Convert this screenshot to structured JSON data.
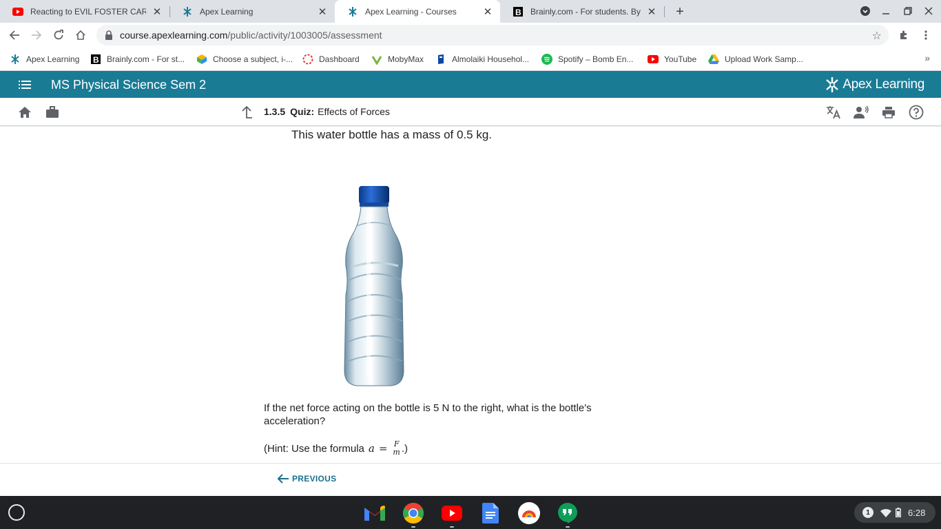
{
  "browser": {
    "tabs": [
      {
        "title": "Reacting to EVIL FOSTER CARE M",
        "favicon": "youtube-icon",
        "active": false
      },
      {
        "title": "Apex Learning",
        "favicon": "apex-icon",
        "active": false
      },
      {
        "title": "Apex Learning - Courses",
        "favicon": "apex-icon",
        "active": true
      },
      {
        "title": "Brainly.com - For students. By st",
        "favicon": "brainly-icon",
        "active": false
      }
    ],
    "url_host": "course.apexlearning.com",
    "url_path": "/public/activity/1003005/assessment",
    "bookmarks": [
      {
        "label": "Apex Learning",
        "icon": "apex-icon"
      },
      {
        "label": "Brainly.com - For st...",
        "icon": "brainly-icon"
      },
      {
        "label": "Choose a subject, i-...",
        "icon": "cube-icon"
      },
      {
        "label": "Dashboard",
        "icon": "dashboard-icon"
      },
      {
        "label": "MobyMax",
        "icon": "mobymax-icon"
      },
      {
        "label": "Almolaiki Househol...",
        "icon": "bookmark-icon"
      },
      {
        "label": "Spotify – Bomb En...",
        "icon": "spotify-icon"
      },
      {
        "label": "YouTube",
        "icon": "youtube-icon"
      },
      {
        "label": "Upload Work Samp...",
        "icon": "drive-icon"
      }
    ],
    "more_bookmarks": "»"
  },
  "app": {
    "course_title": "MS Physical Science Sem 2",
    "brand": "Apex Learning",
    "activity_number": "1.3.5",
    "activity_type": "Quiz:",
    "activity_title": "Effects of Forces"
  },
  "question": {
    "lead": "This water bottle has a mass of 0.5 kg.",
    "prompt": "If the net force acting on the bottle is 5 N to the right, what is the bottle's acceleration?",
    "hint_prefix": "(Hint: Use the formula",
    "hint_var": "a",
    "hint_eq": "=",
    "hint_num": "F",
    "hint_den": "m",
    "hint_suffix": ".)"
  },
  "footer": {
    "previous_label": "PREVIOUS"
  },
  "shelf": {
    "notification_count": "1",
    "time": "6:28",
    "apps": [
      "gmail-icon",
      "chrome-icon",
      "youtube-icon",
      "docs-icon",
      "photos-icon",
      "hangouts-icon"
    ]
  }
}
